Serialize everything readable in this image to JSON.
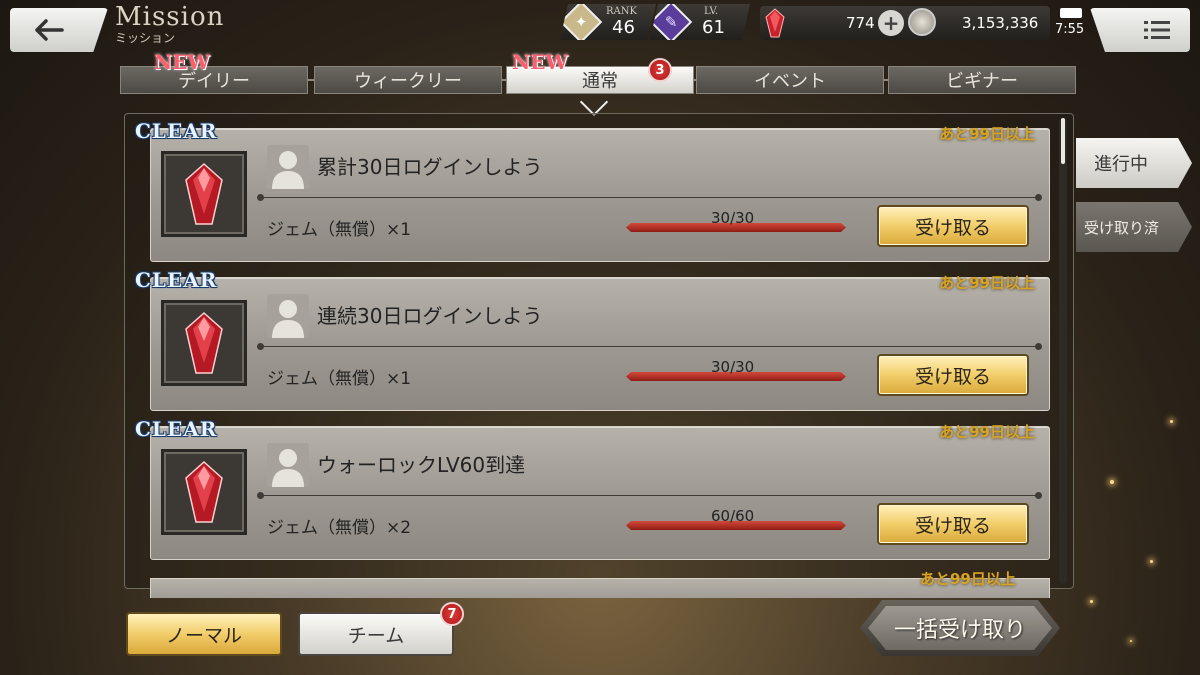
{
  "header": {
    "title": "Mission",
    "subtitle": "ミッション",
    "rank_label": "RANK",
    "rank_value": "46",
    "level_label": "LV.",
    "level_value": "61",
    "gems": "774",
    "gold": "3,153,336",
    "time": "7:55"
  },
  "tabs": [
    {
      "label": "デイリー",
      "new": "NEW"
    },
    {
      "label": "ウィークリー"
    },
    {
      "label": "通常",
      "new": "NEW",
      "badge": "3"
    },
    {
      "label": "イベント"
    },
    {
      "label": "ビギナー"
    }
  ],
  "missions": [
    {
      "clear": "CLEAR",
      "remaining": "あと99日以上",
      "title": "累計30日ログインしよう",
      "reward": "ジェム（無償）×1",
      "progress_text": "30/30",
      "progress": 1.0,
      "claim": "受け取る"
    },
    {
      "clear": "CLEAR",
      "remaining": "あと99日以上",
      "title": "連続30日ログインしよう",
      "reward": "ジェム（無償）×1",
      "progress_text": "30/30",
      "progress": 1.0,
      "claim": "受け取る"
    },
    {
      "clear": "CLEAR",
      "remaining": "あと99日以上",
      "title": "ウォーロックLV60到達",
      "reward": "ジェム（無償）×2",
      "progress_text": "60/60",
      "progress": 1.0,
      "claim": "受け取る"
    }
  ],
  "peek_remaining": "あと99日以上",
  "side_filters": {
    "in_progress": "進行中",
    "claimed": "受け取り済"
  },
  "bottom": {
    "normal": "ノーマル",
    "team": "チーム",
    "team_badge": "7",
    "claim_all": "一括受け取り"
  },
  "colors": {
    "accent_gold": "#f2cd6a",
    "badge_red": "#d02a2a",
    "progress_red": "#b8342a",
    "remaining_gold": "#d8a426"
  }
}
